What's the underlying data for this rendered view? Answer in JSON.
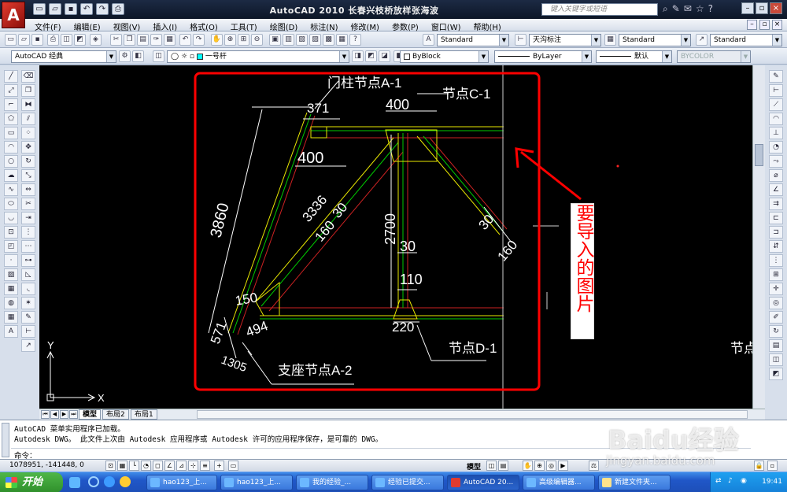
{
  "titlebar": {
    "app_title": "AutoCAD 2010   长春兴枝桥放样张海波",
    "logo_letter": "A",
    "help_search_placeholder": "键入关键字或短语",
    "quick_access": [
      "新建",
      "打开",
      "保存",
      "放弃",
      "重做",
      "打印"
    ]
  },
  "menubar": {
    "items": [
      "文件(F)",
      "编辑(E)",
      "视图(V)",
      "插入(I)",
      "格式(O)",
      "工具(T)",
      "绘图(D)",
      "标注(N)",
      "修改(M)",
      "参数(P)",
      "窗口(W)",
      "帮助(H)"
    ]
  },
  "toolbar1": {
    "text_style": "Standard",
    "dim_style": "天沟标注",
    "table_style": "Standard",
    "multileader_style": "Standard"
  },
  "toolbar2": {
    "workspace": "AutoCAD 经典",
    "layer": "一号杆",
    "color": "ByBlock",
    "linetype": "ByLayer",
    "lineweight": "默认",
    "plot_style": "BYCOLOR"
  },
  "colors": {
    "layer_swatch": "#00ffff",
    "annotation": "#ff0000",
    "drawing_yellow": "#e8e800",
    "drawing_green": "#00cc00",
    "drawing_red": "#cc2222",
    "dim_white": "#ffffff"
  },
  "drawing": {
    "labels": {
      "node_a1": "门柱节点A-1",
      "node_c1": "节点C-1",
      "node_d1": "节点D-1",
      "node_a2": "支座节点A-2",
      "node_partial": "节点"
    },
    "dims": {
      "d371": "371",
      "d400_top": "400",
      "d400_left": "400",
      "d3860": "3860",
      "d3336": "3336",
      "d30_a": "30",
      "d160_a": "160",
      "d2700": "2700",
      "d30_mid": "30",
      "d110": "110",
      "d30_right": "30",
      "d160_right": "160",
      "d150": "150",
      "d571": "571",
      "d494": "494",
      "d1305": "1305",
      "d220": "220"
    },
    "annotation_text": "要导入的图片",
    "ucs_x": "X",
    "ucs_y": "Y"
  },
  "layout_tabs": [
    "模型",
    "布局2",
    "布局1"
  ],
  "command": {
    "line1": "AutoCAD 菜单实用程序已加载。",
    "line2": "Autodesk DWG。  此文件上次由 Autodesk 应用程序或 Autodesk 许可的应用程序保存，是可靠的 DWG。",
    "prompt": "命令："
  },
  "status": {
    "coords": "1078951, -141448, 0",
    "model": "模型"
  },
  "taskbar": {
    "start": "开始",
    "items": [
      "hao123_上...",
      "hao123_上...",
      "我的经验_...",
      "经验已提交...",
      "AutoCAD 20...",
      "高级编辑器...",
      "新建文件夹..."
    ],
    "clock": "19:41"
  },
  "watermark": {
    "logo": "Baidu经验",
    "url": "jingyan.baidu.com"
  }
}
